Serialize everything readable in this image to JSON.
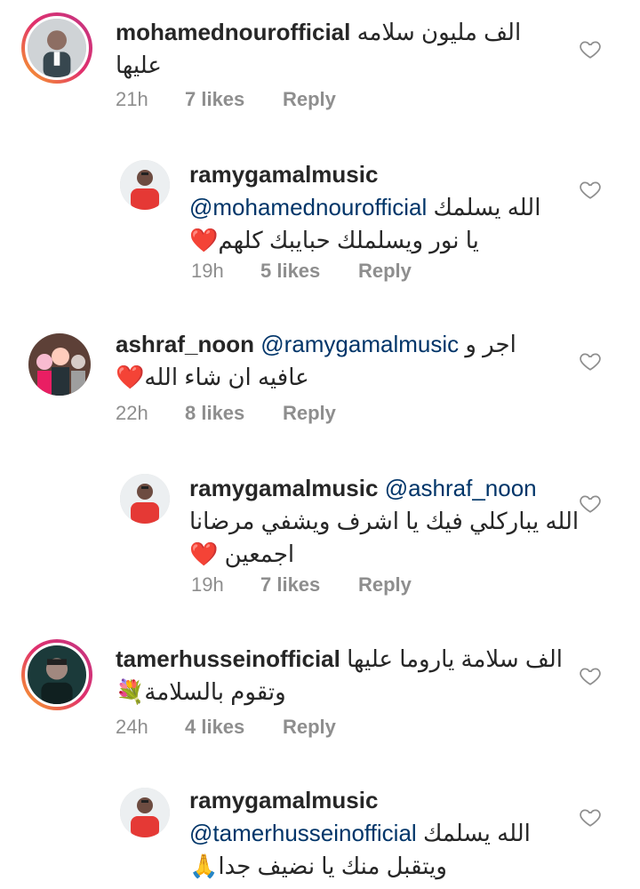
{
  "comments": [
    {
      "username": "mohamednourofficial",
      "line1_text": "الف مليون سلامه",
      "line2_text": "عليها",
      "time": "21h",
      "likes": "7 likes",
      "reply": "Reply"
    },
    {
      "username": "ramygamalmusic",
      "mention": "@mohamednourofficial",
      "line1_text": "الله يسلمك",
      "line2_text": "يا نور ويسلملك حبايبك كلهم",
      "line2_emoji": "❤️",
      "time": "19h",
      "likes": "5 likes",
      "reply": "Reply"
    },
    {
      "username": "ashraf_noon",
      "mention": "@ramygamalmusic",
      "line1_text": "اجر و",
      "line2_text": "عافيه ان شاء الله",
      "line2_emoji": "❤️",
      "time": "22h",
      "likes": "8 likes",
      "reply": "Reply"
    },
    {
      "username": "ramygamalmusic",
      "mention": "@ashraf_noon",
      "line1_text": "الله يباركلي فيك يا اشرف ويشفي مرضانا",
      "line2_text": "اجمعين",
      "line2_emoji": "❤️",
      "time": "19h",
      "likes": "7 likes",
      "reply": "Reply"
    },
    {
      "username": "tamerhusseinofficial",
      "line1_text": "الف سلامة ياروما عليها",
      "line2_text": "وتقوم بالسلامة",
      "line2_emoji": "💐",
      "time": "24h",
      "likes": "4 likes",
      "reply": "Reply"
    },
    {
      "username": "ramygamalmusic",
      "mention": "@tamerhusseinofficial",
      "line1_text": "الله يسلمك",
      "line2_text": "ويتقبل منك يا نضيف جدا",
      "line2_emoji": "🙏",
      "time": "",
      "likes": "",
      "reply": ""
    }
  ],
  "icons": {
    "like": "heart-outline-icon"
  },
  "colors": {
    "mention": "#003569",
    "meta": "#8e8e8e",
    "story_ring_start": "#f9a825",
    "story_ring_end": "#c13584"
  }
}
